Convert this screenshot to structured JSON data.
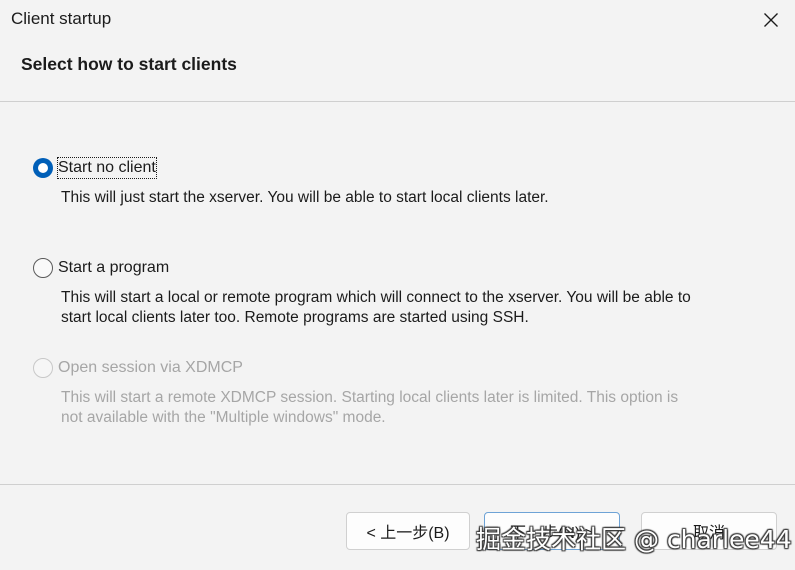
{
  "window": {
    "title": "Client startup"
  },
  "header": {
    "title": "Select how to start clients"
  },
  "options": [
    {
      "label": "Start no client",
      "description": "This will just start the xserver. You will be able to start local clients later.",
      "checked": true,
      "disabled": false
    },
    {
      "label": "Start a program",
      "description": "This will start a local or remote program which will connect to the xserver. You will be able to start local clients later too. Remote programs are started using SSH.",
      "checked": false,
      "disabled": false
    },
    {
      "label": "Open session via XDMCP",
      "description": "This will start a remote XDMCP session. Starting local clients later is limited. This option is not available with the \"Multiple windows\" mode.",
      "checked": false,
      "disabled": true
    }
  ],
  "buttons": {
    "back": "< 上一步(B)",
    "next": "下一步(N) >",
    "cancel": "取消"
  },
  "watermark": "掘金技术社区 @ charlee44",
  "colors": {
    "accent": "#005fb8",
    "disabled_text": "#a6a6a6",
    "background": "#f3f3f3"
  }
}
